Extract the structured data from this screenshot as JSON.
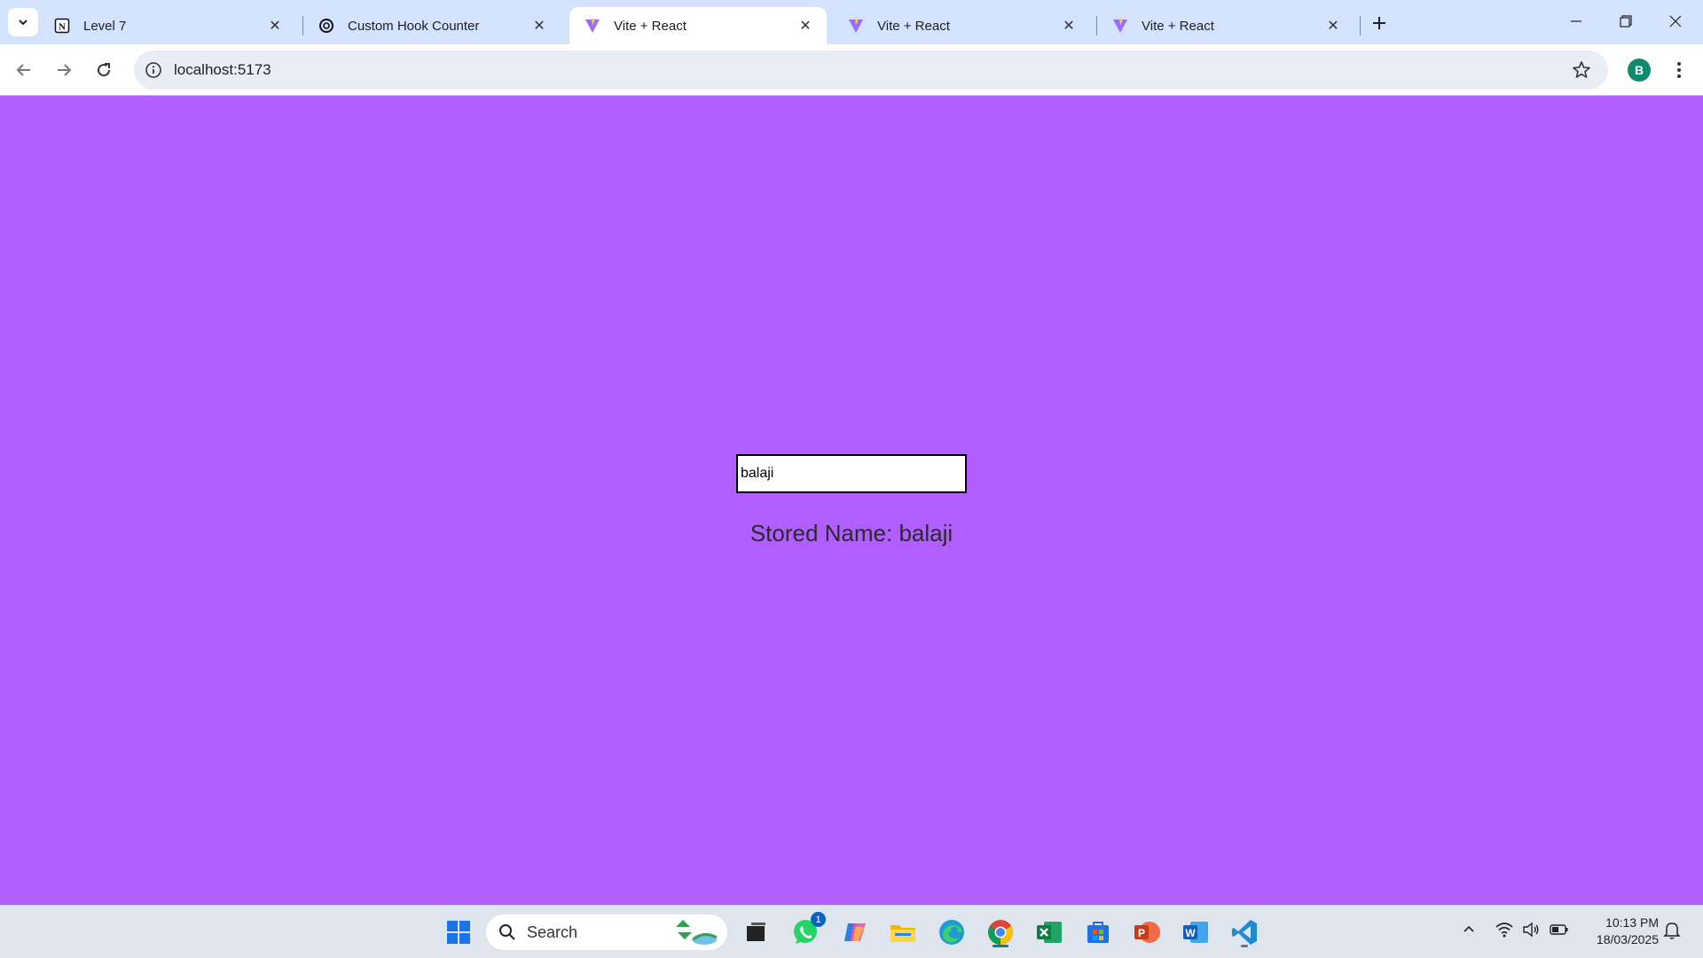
{
  "browser": {
    "tabs": [
      {
        "title": "Level 7",
        "icon": "notion-icon",
        "active": false
      },
      {
        "title": "Custom Hook Counter",
        "icon": "openai-icon",
        "active": false
      },
      {
        "title": "Vite + React",
        "icon": "vite-icon",
        "active": true
      },
      {
        "title": "Vite + React",
        "icon": "vite-icon",
        "active": false
      },
      {
        "title": "Vite + React",
        "icon": "vite-icon",
        "active": false
      }
    ],
    "url": "localhost:5173",
    "profile_initial": "B"
  },
  "page": {
    "background": "#b15eff",
    "input_value": "balaji",
    "stored_text": "Stored Name: balaji"
  },
  "taskbar": {
    "search_label": "Search",
    "time": "10:13 PM",
    "date": "18/03/2025",
    "whatsapp_badge": "1"
  }
}
